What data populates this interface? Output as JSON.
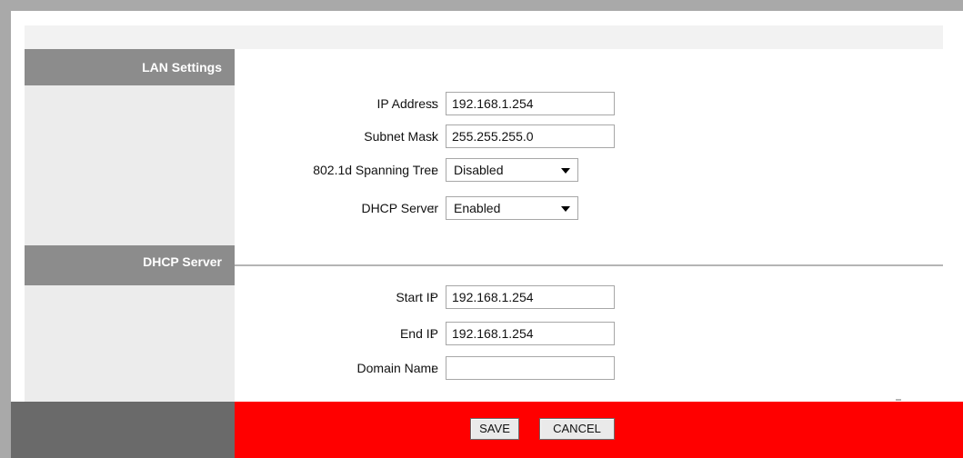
{
  "sections": {
    "lan": {
      "title": "LAN Settings",
      "fields": {
        "ip_address": {
          "label": "IP Address",
          "value": "192.168.1.254"
        },
        "subnet_mask": {
          "label": "Subnet Mask",
          "value": "255.255.255.0"
        },
        "spanning_tree": {
          "label": "802.1d Spanning Tree",
          "value": "Disabled"
        },
        "dhcp_server": {
          "label": "DHCP Server",
          "value": "Enabled"
        }
      }
    },
    "dhcp": {
      "title": "DHCP Server",
      "fields": {
        "start_ip": {
          "label": "Start IP",
          "value": "192.168.1.254"
        },
        "end_ip": {
          "label": "End IP",
          "value": "192.168.1.254"
        },
        "domain_name": {
          "label": "Domain Name",
          "value": ""
        }
      }
    }
  },
  "colon": ":",
  "buttons": {
    "save": "SAVE",
    "cancel": "CANCEL"
  },
  "colors": {
    "footer_bar": "#ff0000",
    "section_header": "#8c8c8c"
  }
}
